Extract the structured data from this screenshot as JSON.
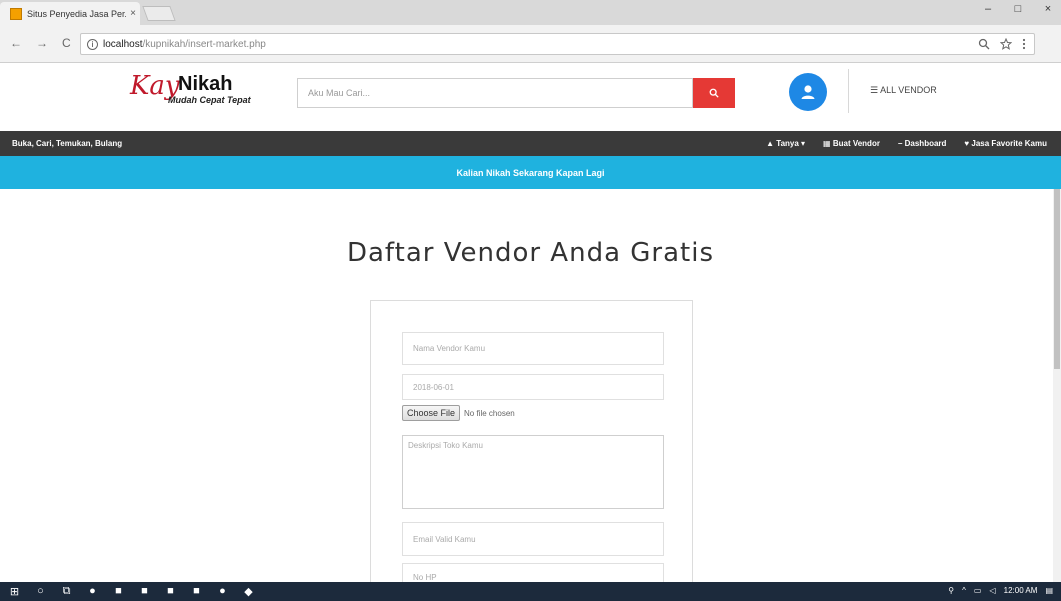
{
  "browser": {
    "tab_title": "Situs Penyedia Jasa Per...",
    "tab_close": "×",
    "window_controls": [
      "–",
      "□",
      "×"
    ],
    "url_host": "localhost",
    "url_path": "/kupnikah/insert-market.php",
    "nav": {
      "back": "←",
      "forward": "→",
      "reload": "C"
    }
  },
  "header": {
    "logo_script": "Kay",
    "logo_word": "Nikah",
    "logo_tagline": "Mudah Cepat Tepat",
    "search_placeholder": "Aku Mau Cari...",
    "all_vendor_label": "ALL VENDOR"
  },
  "topnav": {
    "slogan": "Buka, Cari, Temukan, Bulang",
    "menu": [
      "Tanya ▾",
      "Buat Vendor",
      "Dashboard",
      "Jasa Favorite Kamu"
    ]
  },
  "banner": {
    "text": "Kalian Nikah Sekarang Kapan Lagi"
  },
  "main": {
    "title": "Daftar Vendor Anda Gratis",
    "form": {
      "name_placeholder": "Nama Vendor Kamu",
      "date_value": "2018-06-01",
      "file_button": "Choose File",
      "file_status": "No file chosen",
      "description_placeholder": "Deskripsi Toko Kamu",
      "email_placeholder": "Email Valid Kamu",
      "phone_placeholder": "No HP"
    }
  },
  "taskbar": {
    "clock": "12:00 AM"
  },
  "colors": {
    "nav_dark": "#3a3a3a",
    "banner_blue": "#1fb2df",
    "search_red": "#e53935",
    "user_blue": "#1e88e5",
    "logo_red": "#c0192b"
  }
}
